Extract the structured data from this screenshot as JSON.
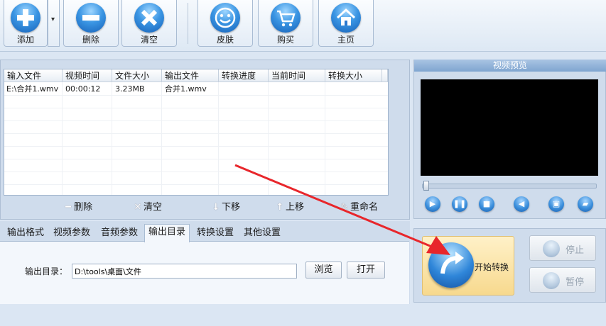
{
  "toolbar": {
    "buttons": [
      {
        "id": "add",
        "label": "添加",
        "icon": "plus-icon"
      },
      {
        "id": "delete",
        "label": "删除",
        "icon": "minus-icon"
      },
      {
        "id": "clear",
        "label": "清空",
        "icon": "x-icon"
      },
      {
        "id": "skin",
        "label": "皮肤",
        "icon": "smiley-icon"
      },
      {
        "id": "buy",
        "label": "购买",
        "icon": "cart-icon"
      },
      {
        "id": "home",
        "label": "主页",
        "icon": "home-icon"
      }
    ],
    "add_dropdown_glyph": "▾"
  },
  "file_table": {
    "columns": [
      "输入文件",
      "视频时间",
      "文件大小",
      "输出文件",
      "转换进度",
      "当前时间",
      "转换大小"
    ],
    "rows": [
      [
        "E:\\合并1.wmv",
        "00:00:12",
        "3.23MB",
        "合并1.wmv",
        "",
        "",
        ""
      ]
    ]
  },
  "list_actions": {
    "delete": "删除",
    "clear": "清空",
    "move_down": "下移",
    "move_up": "上移",
    "rename": "重命名"
  },
  "tabs": {
    "items": [
      "输出格式",
      "视频参数",
      "音频参数",
      "输出目录",
      "转换设置",
      "其他设置"
    ],
    "active": "输出目录"
  },
  "output_dir": {
    "label": "输出目录：",
    "value": "D:\\tools\\桌面\\文件",
    "browse": "浏览",
    "open": "打开"
  },
  "preview": {
    "title": "视频预览",
    "progress": 0.0
  },
  "convert": {
    "start": "开始转换",
    "stop": "停止",
    "pause": "暂停"
  },
  "colors": {
    "arrow": "#e8262b",
    "accent": "#2f7fd1"
  }
}
